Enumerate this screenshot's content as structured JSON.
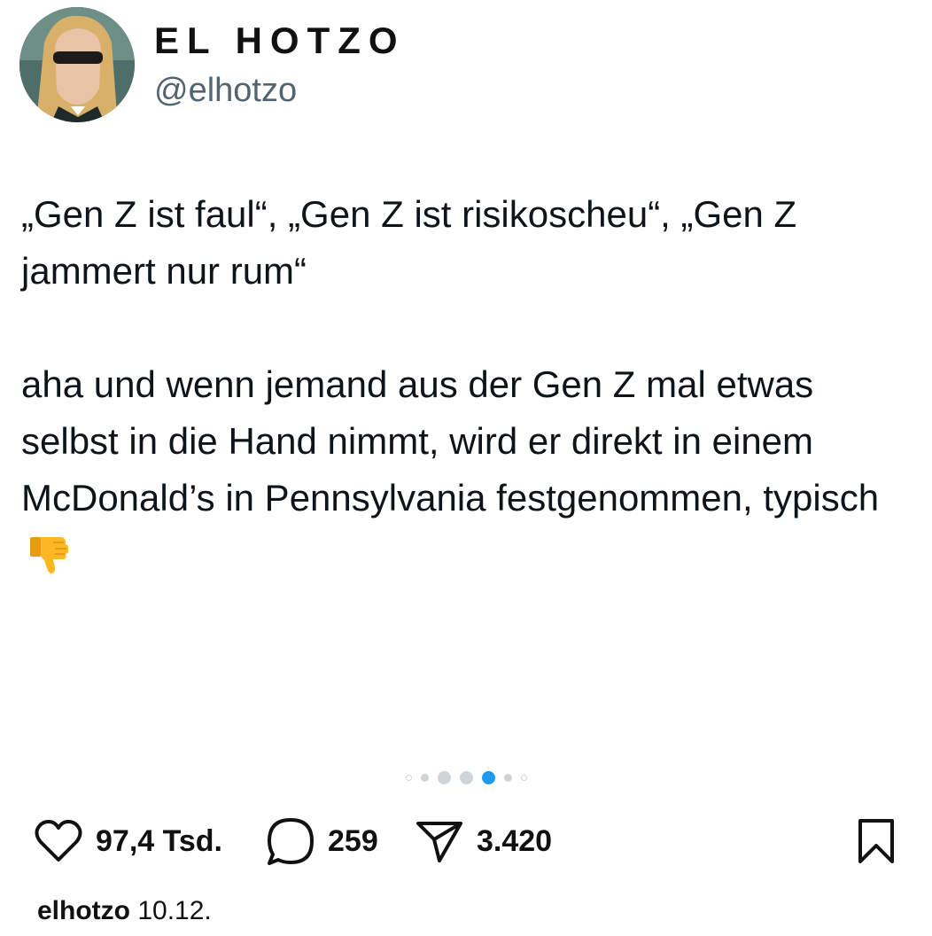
{
  "profile": {
    "display_name": "EL HOTZO",
    "handle": "@elhotzo"
  },
  "tweet": {
    "paragraph_1": "„Gen Z ist faul“, „Gen Z ist risikoscheu“, „Gen Z jammert nur rum“",
    "paragraph_2": "aha und wenn jemand aus der Gen Z mal etwas selbst in die Hand nimmt, wird er direkt in einem McDonald’s in Pennsylvania festgenommen, typisch",
    "emoji": "thumbs-down-icon"
  },
  "carousel": {
    "total_dots": 7,
    "active_index": 4,
    "active_color": "#1d9bf0"
  },
  "actions": {
    "likes": "97,4 Tsd.",
    "comments": "259",
    "shares": "3.420"
  },
  "footer": {
    "username": "elhotzo",
    "date": "10.12."
  }
}
